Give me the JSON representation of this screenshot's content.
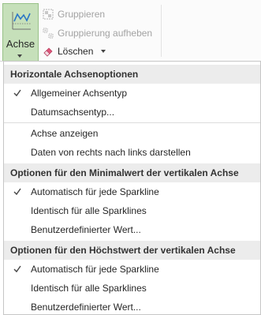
{
  "ribbon": {
    "axis_button_label": "Achse",
    "group_label": "Gruppieren",
    "ungroup_label": "Gruppierung aufheben",
    "delete_label": "Löschen"
  },
  "menu": {
    "section1": {
      "header": "Horizontale Achsenoptionen",
      "items": [
        {
          "label": "Allgemeiner Achsentyp",
          "checked": true
        },
        {
          "label": "Datumsachsentyp...",
          "checked": false
        }
      ],
      "items2": [
        {
          "label": "Achse anzeigen",
          "checked": false
        },
        {
          "label": "Daten von rechts nach links darstellen",
          "checked": false
        }
      ]
    },
    "section2": {
      "header": "Optionen für den Minimalwert der vertikalen Achse",
      "items": [
        {
          "label": "Automatisch für jede Sparkline",
          "checked": true
        },
        {
          "label": "Identisch für alle Sparklines",
          "checked": false
        },
        {
          "label": "Benutzerdefinierter Wert...",
          "checked": false
        }
      ]
    },
    "section3": {
      "header": "Optionen für den Höchstwert der vertikalen Achse",
      "items": [
        {
          "label": "Automatisch für jede Sparkline",
          "checked": true
        },
        {
          "label": "Identisch für alle Sparklines",
          "checked": false
        },
        {
          "label": "Benutzerdefinierter Wert...",
          "checked": false
        }
      ]
    }
  },
  "colors": {
    "axis_button_bg": "#c6e0ba",
    "header_bg": "#ececec",
    "disabled_text": "#a3a3a3"
  }
}
